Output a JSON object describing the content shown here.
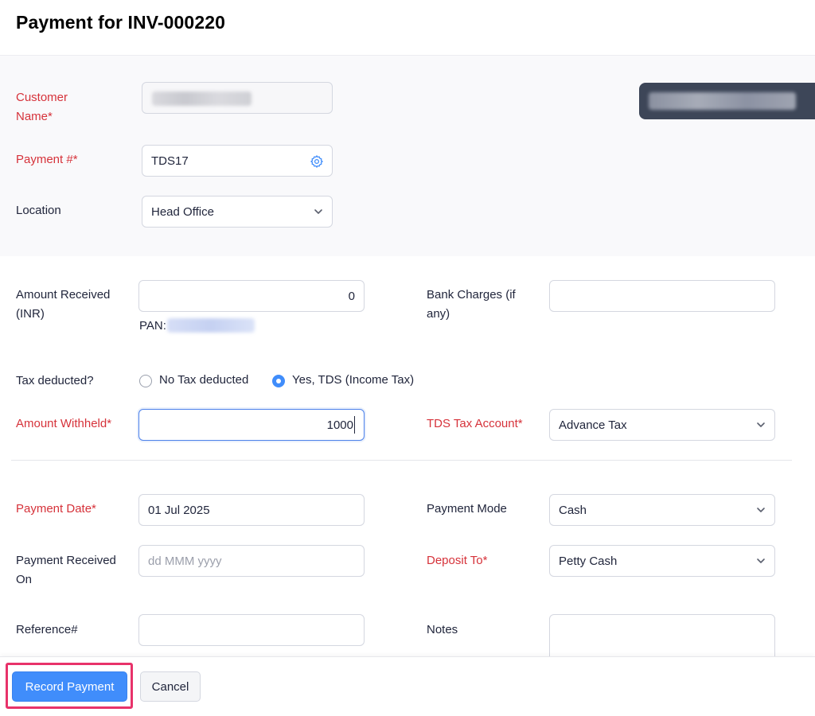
{
  "header": {
    "title": "Payment for INV-000220"
  },
  "top": {
    "customer_name_label_line1": "Customer",
    "customer_name_label_line2": "Name*",
    "payment_number_label": "Payment #*",
    "payment_number_value": "TDS17",
    "location_label": "Location",
    "location_value": "Head Office"
  },
  "amounts": {
    "amount_received_label_line1": "Amount Received",
    "amount_received_label_line2": "(INR)",
    "amount_received_value": "0",
    "pan_label": "PAN:",
    "bank_charges_label_line1": "Bank Charges (if",
    "bank_charges_label_line2": "any)",
    "bank_charges_value": ""
  },
  "tax": {
    "question_label": "Tax deducted?",
    "option_no": "No Tax deducted",
    "option_yes": "Yes, TDS (Income Tax)",
    "selected": "yes",
    "amount_withheld_label": "Amount Withheld*",
    "amount_withheld_value": "1000",
    "tds_account_label": "TDS Tax Account*",
    "tds_account_value": "Advance Tax"
  },
  "payment": {
    "date_label": "Payment Date*",
    "date_value": "01 Jul 2025",
    "mode_label": "Payment Mode",
    "mode_value": "Cash",
    "received_on_label_line1": "Payment Received",
    "received_on_label_line2": "On",
    "received_on_placeholder": "dd MMM yyyy",
    "deposit_to_label": "Deposit To*",
    "deposit_to_value": "Petty Cash",
    "reference_label": "Reference#",
    "reference_value": "",
    "notes_label": "Notes",
    "notes_value": ""
  },
  "footer": {
    "record_label": "Record Payment",
    "cancel_label": "Cancel"
  },
  "colors": {
    "required": "#d6323a",
    "primary": "#408dfb",
    "highlight": "#e8326a"
  },
  "icons": {
    "payment_settings": "gear-icon",
    "dropdown": "chevron-down-icon"
  }
}
